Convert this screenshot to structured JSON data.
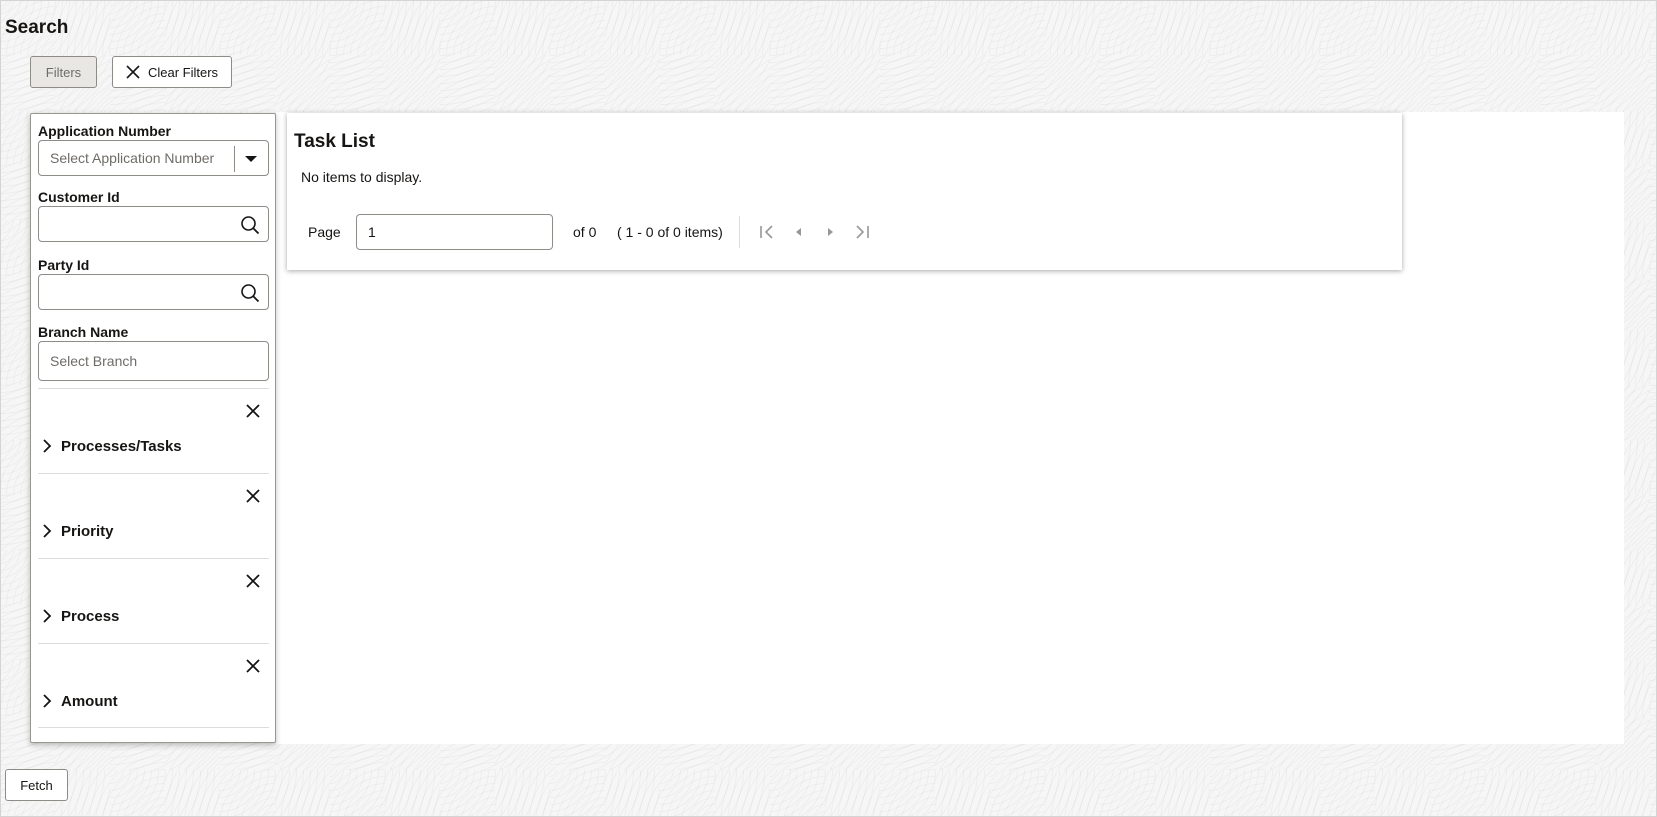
{
  "page": {
    "title": "Search"
  },
  "toolbar": {
    "filters_label": "Filters",
    "clear_filters_label": "Clear Filters"
  },
  "filters": {
    "application_number": {
      "label": "Application Number",
      "placeholder": "Select Application Number"
    },
    "customer_id": {
      "label": "Customer Id",
      "value": ""
    },
    "party_id": {
      "label": "Party Id",
      "value": ""
    },
    "branch_name": {
      "label": "Branch Name",
      "placeholder": "Select Branch"
    },
    "sections": [
      {
        "title": "Processes/Tasks"
      },
      {
        "title": "Priority"
      },
      {
        "title": "Process"
      },
      {
        "title": "Amount"
      }
    ]
  },
  "task_list": {
    "title": "Task List",
    "empty_message": "No items to display.",
    "pager": {
      "page_label": "Page",
      "page_value": "1",
      "of_text": "of 0",
      "range_text": "( 1 - 0 of 0 items)"
    }
  },
  "footer": {
    "fetch_label": "Fetch"
  },
  "icons": {
    "close": "close-icon",
    "search": "search-icon",
    "caret": "caret-down-icon",
    "chevron": "chevron-right-icon",
    "first": "first-page-icon",
    "prev": "previous-page-icon",
    "next": "next-page-icon",
    "last": "last-page-icon"
  }
}
